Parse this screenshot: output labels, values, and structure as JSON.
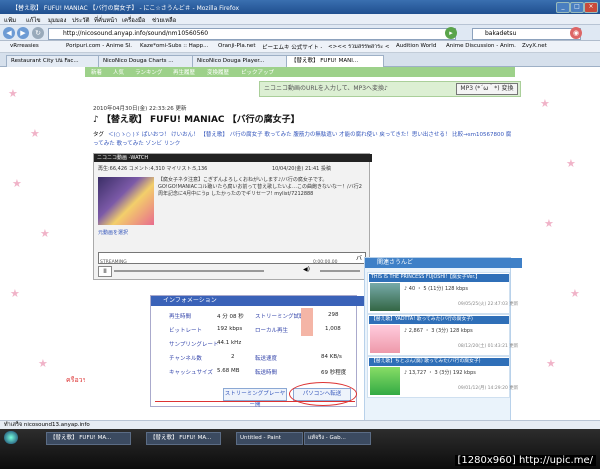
{
  "window": {
    "title": "【替え歌】 FUFU! MANIAC 【バ行の腐女子】 - にこ☆さうんど＃ - Mozilla Firefox"
  },
  "menu": [
    "แฟ้ม",
    "แก้ไข",
    "มุมมอง",
    "ประวัติ",
    "ที่คั่นหน้า",
    "เครื่องมือ",
    "ช่วยเหลือ"
  ],
  "nav": {
    "url": "http://nicosound.anyap.info/sound/nm10560560",
    "search_value": "bakadetsu"
  },
  "bookmarks": [
    "vRrreasies",
    "Poripuri.com - Anime Sl...",
    "Kaze*omi-Subs :: Happ...",
    "Oranji-Pla.net",
    "ピーエムキ 公式サイト -...",
    "<><< รวมสรรพสาระ <<<<...",
    "Audition World",
    "Anime Discussion - Anim...",
    "ZvyX.net"
  ],
  "tabs": [
    "Restaurant City บน Fac...",
    "NicoNico Douga Charts ...",
    "NicoNico Douga Player...",
    "【替え歌】 FUFU! MANI..."
  ],
  "page": {
    "topnav": [
      "新着",
      "人気",
      "ランキング",
      "再生履歴",
      "変換履歴",
      "ピックアップ"
    ],
    "convert_text": "ニコニコ動画のURLを入力して、MP3へ変換♪",
    "mp3_button": "MP3 (*´ω｀*) 変換",
    "date": "2010年04月30日(金) 22:33:26 更新",
    "title": "♪ 【替え歌】 FUFU! MANIAC 【バ行の腐女子】",
    "tag_label": "タグ",
    "tags": "＜(○ゝ○ )ゞ ぱいおつ！ けいおん！ 【替え歌】 バ行の腐女子 歌ってみた 腹筋力の無駄遣い 才能の腐れ使い 戻ってきた！思い出させる！ 比較→sm10567800 腐ってみた 歌ってみた ゾンビ リンク",
    "player": {
      "bar": "ニコニコ動画 -WATCH",
      "stats": "再生:66,426 コメント:4,310 マイリスト:5,136",
      "posted": "10/04/20(金) 21:41 投稿",
      "comment": "【腐女子ネタ注意】こぎずんよろしくおねがいします♪/バ行の腐女子です。GO!GO!MANIACコル聴いたら腐いお前って替え歌したいよ…この曲飽きないなー！/バ行2周年記念に4月中にうp したかったのでギリセーフ! mylist/7212888",
      "video_label": "元動画を選択",
      "scrub_label": "STREAMING",
      "time": "0:00:00.00"
    },
    "info": {
      "header": "インフォメーション",
      "rows": [
        {
          "label": "再生時間",
          "value": "4 分 08 秒",
          "label2": "ストリーミング試聴",
          "value2": "298"
        },
        {
          "label": "ビットレート",
          "value": "192 kbps",
          "label2": "ローカル再生",
          "value2": "1,008"
        },
        {
          "label": "サンプリングレート",
          "value": "44.1 kHz",
          "label2": "",
          "value2": ""
        },
        {
          "label": "チャンネル数",
          "value": "2",
          "label2": "転送速度",
          "value2": "84 KB/s"
        },
        {
          "label": "キャッシュサイズ",
          "value": "5.68 MB",
          "label2": "転送時間",
          "value2": "69 秒程度"
        }
      ],
      "button_stream": "ストリーミングプレーヤー開",
      "button_transfer": "パソコンへ転送"
    },
    "sidebar": {
      "header": "関連さうんど",
      "items": [
        {
          "title": "THIS IS THE PRINCESS FUJOSHI!【腐女子Ver.】",
          "stats": "♪ 40 ・ 5 (11分) 128 kbps",
          "date": "09/05/25(火) 22:47:03 更新"
        },
        {
          "title": "【替え歌】YADTTA! 歌ってみた(バ行の腐女子)",
          "stats": "♪ 2,867 ・ 3 (3分) 128 kbps",
          "date": "08/12/20(土) 01:43:21 更新"
        },
        {
          "title": "【替え歌】ちとぶん(腐) 歌ってみた(バ行の腐女子)",
          "stats": "♪ 13,727 ・ 3 (3分) 192 kbps",
          "date": "09/01/12(月) 14:29:20 更新"
        }
      ]
    },
    "margin_note": "ครือวรณ์"
  },
  "status": "ทำเสร็จ nicosound13.anyap.info",
  "taskbar": [
    "【替え歌】 FUFU! MA...",
    "【替え歌】 FUFU! MA...",
    "Untitled - Paint",
    "แท้จริง - Gab..."
  ],
  "watermark": "[1280x960] http://upic.me/"
}
